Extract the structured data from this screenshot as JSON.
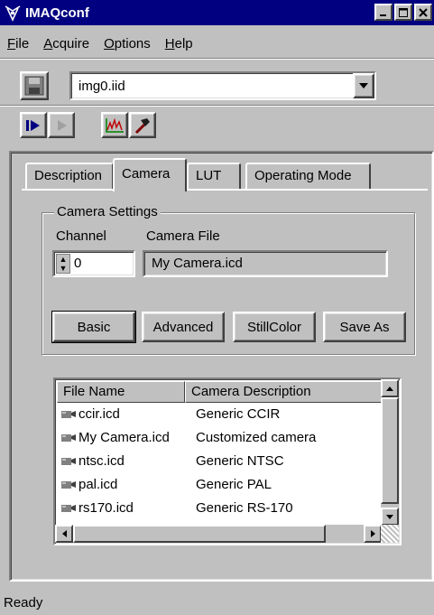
{
  "window": {
    "title": "IMAQconf"
  },
  "menu": [
    {
      "label": "File",
      "accel": "F",
      "rest": "ile"
    },
    {
      "label": "Acquire",
      "accel": "A",
      "rest": "cquire"
    },
    {
      "label": "Options",
      "accel": "O",
      "rest": "ptions"
    },
    {
      "label": "Help",
      "accel": "H",
      "rest": "elp"
    }
  ],
  "toolbar": {
    "interface_file": "img0.iid"
  },
  "tabs": [
    "Description",
    "Camera",
    "LUT",
    "Operating Mode"
  ],
  "camera_settings": {
    "group_title": "Camera Settings",
    "channel_label": "Channel",
    "camera_file_label": "Camera File",
    "channel_value": "0",
    "camera_file_value": "My Camera.icd"
  },
  "buttons": {
    "basic": "Basic",
    "advanced": "Advanced",
    "stillcolor": "StillColor",
    "save_as": "Save As"
  },
  "file_list": {
    "columns": [
      "File Name",
      "Camera Description"
    ],
    "rows": [
      {
        "name": "ccir.icd",
        "desc": "Generic CCIR"
      },
      {
        "name": "My Camera.icd",
        "desc": "Customized camera"
      },
      {
        "name": "ntsc.icd",
        "desc": "Generic NTSC"
      },
      {
        "name": "pal.icd",
        "desc": "Generic PAL"
      },
      {
        "name": "rs170.icd",
        "desc": "Generic RS-170"
      }
    ]
  },
  "status": {
    "text": "Ready"
  }
}
